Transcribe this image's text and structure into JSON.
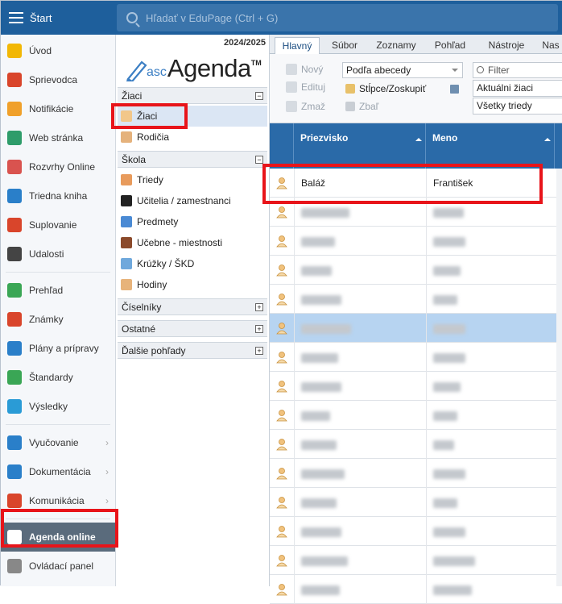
{
  "topbar": {
    "start_label": "Štart",
    "search_placeholder": "Hľadať v EduPage (Ctrl + G)"
  },
  "leftnav": {
    "items": [
      {
        "label": "Úvod",
        "icon": "star-icon",
        "color": "#f2b705"
      },
      {
        "label": "Sprievodca",
        "icon": "magic-wand-icon",
        "color": "#d9452b"
      },
      {
        "label": "Notifikácie",
        "icon": "envelope-icon",
        "color": "#f0a02a"
      },
      {
        "label": "Web stránka",
        "icon": "home-icon",
        "color": "#2e9c6a"
      },
      {
        "label": "Rozvrhy Online",
        "icon": "grid-calendar-icon",
        "color": "#d9534f"
      },
      {
        "label": "Triedna kniha",
        "icon": "book-icon",
        "color": "#2a7fc9"
      },
      {
        "label": "Suplovanie",
        "icon": "person-icon",
        "color": "#d9452b"
      },
      {
        "label": "Udalosti",
        "icon": "calendar-icon",
        "color": "#444"
      },
      {
        "label": "Prehľad",
        "icon": "check-circle-icon",
        "color": "#3aa655"
      },
      {
        "label": "Známky",
        "icon": "grade-icon",
        "color": "#d9452b"
      },
      {
        "label": "Plány a prípravy",
        "icon": "briefcase-icon",
        "color": "#2a7fc9"
      },
      {
        "label": "Štandardy",
        "icon": "shield-check-icon",
        "color": "#3aa655"
      },
      {
        "label": "Výsledky",
        "icon": "bar-chart-icon",
        "color": "#2a9bd6"
      },
      {
        "label": "Vyučovanie",
        "icon": "open-book-icon",
        "color": "#2a7fc9"
      },
      {
        "label": "Dokumentácia",
        "icon": "document-icon",
        "color": "#2a7fc9"
      },
      {
        "label": "Komunikácia",
        "icon": "chat-icon",
        "color": "#d9452b"
      },
      {
        "label": "Agenda online",
        "icon": "pen-icon",
        "color": "#ffffff"
      },
      {
        "label": "Ovládací panel",
        "icon": "gear-icon",
        "color": "#888"
      }
    ]
  },
  "agenda": {
    "year": "2024/2025",
    "logo": {
      "asc": "asc",
      "name": "Agenda",
      "tm": "TM"
    },
    "sections": [
      {
        "title": "Žiaci",
        "toggle": "−"
      },
      {
        "title": "Škola",
        "toggle": "−"
      },
      {
        "title": "Číselníky",
        "toggle": "+"
      },
      {
        "title": "Ostatné",
        "toggle": "+"
      },
      {
        "title": "Ďalšie pohľady",
        "toggle": "+"
      }
    ],
    "items": [
      {
        "label": "Žiaci",
        "icon": "student-icon"
      },
      {
        "label": "Rodičia",
        "icon": "parents-icon"
      },
      {
        "label": "Triedy",
        "icon": "class-icon"
      },
      {
        "label": "Učitelia / zamestnanci",
        "icon": "graduation-cap-icon"
      },
      {
        "label": "Predmety",
        "icon": "subject-icon"
      },
      {
        "label": "Učebne - miestnosti",
        "icon": "door-icon"
      },
      {
        "label": "Krúžky / ŠKD",
        "icon": "rocket-icon"
      },
      {
        "label": "Hodiny",
        "icon": "people-icon"
      }
    ]
  },
  "main": {
    "tabs": [
      "Hlavný",
      "Súbor",
      "Zoznamy",
      "Pohľad",
      "Nástroje",
      "Nas"
    ],
    "ribbon": {
      "new": "Nový",
      "edit": "Edituj",
      "delete": "Zmaž",
      "sort": "Podľa abecedy",
      "columns": "Stĺpce/Zoskupiť",
      "collapse": "Zbaľ",
      "filter_placeholder": "Filter",
      "filter_students": "Aktuálni žiaci",
      "filter_classes": "Všetky triedy"
    },
    "grid": {
      "headers": [
        "Priezvisko",
        "Meno"
      ],
      "first_row": {
        "surname": "Baláž",
        "name": "František"
      }
    }
  }
}
